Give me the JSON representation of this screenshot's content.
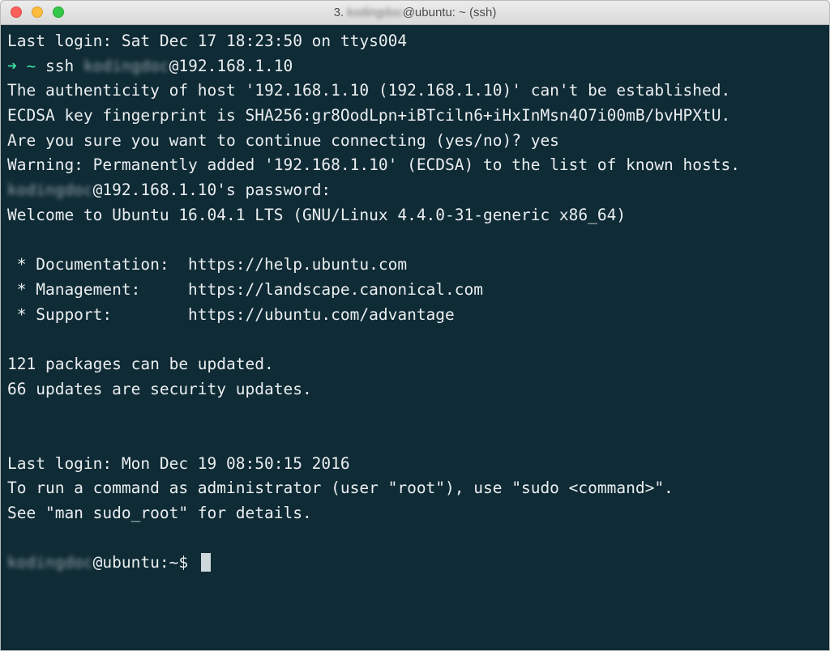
{
  "window": {
    "title_prefix": "3. ",
    "title_user": "kodingdoc",
    "title_suffix": "@ubuntu: ~ (ssh)"
  },
  "colors": {
    "terminal_bg": "#0f2b35",
    "text": "#eaeef0",
    "prompt_accent": "#3ee2a0",
    "traffic_close": "#fc605c",
    "traffic_minimize": "#fdbc40",
    "traffic_maximize": "#34c84a"
  },
  "icons": {
    "prompt": "arrow-right-icon",
    "close": "close-button",
    "minimize": "minimize-button",
    "maximize": "maximize-button"
  },
  "terminal": {
    "last_login_1": "Last login: Sat Dec 17 18:23:50 on ttys004",
    "prompt_arrow": "➜",
    "prompt_tilde": "~",
    "ssh_cmd": "ssh",
    "ssh_user": "kodingdoc",
    "ssh_host": "@192.168.1.10",
    "authenticity": "The authenticity of host '192.168.1.10 (192.168.1.10)' can't be established.",
    "fingerprint": "ECDSA key fingerprint is SHA256:gr8OodLpn+iBTciln6+iHxInMsn4O7i00mB/bvHPXtU.",
    "confirm": "Are you sure you want to continue connecting (yes/no)? yes",
    "warning": "Warning: Permanently added '192.168.1.10' (ECDSA) to the list of known hosts.",
    "password_user": "kodingdoc",
    "password_rest": "@192.168.1.10's password:",
    "welcome": "Welcome to Ubuntu 16.04.1 LTS (GNU/Linux 4.4.0-31-generic x86_64)",
    "doc": " * Documentation:  https://help.ubuntu.com",
    "mgmt": " * Management:     https://landscape.canonical.com",
    "support": " * Support:        https://ubuntu.com/advantage",
    "packages": "121 packages can be updated.",
    "security": "66 updates are security updates.",
    "last_login_2": "Last login: Mon Dec 19 08:50:15 2016",
    "sudo_hint": "To run a command as administrator (user \"root\"), use \"sudo <command>\".",
    "see_man": "See \"man sudo_root\" for details.",
    "prompt_user": "kodingdoc",
    "prompt_rest": "@ubuntu:~$ "
  }
}
